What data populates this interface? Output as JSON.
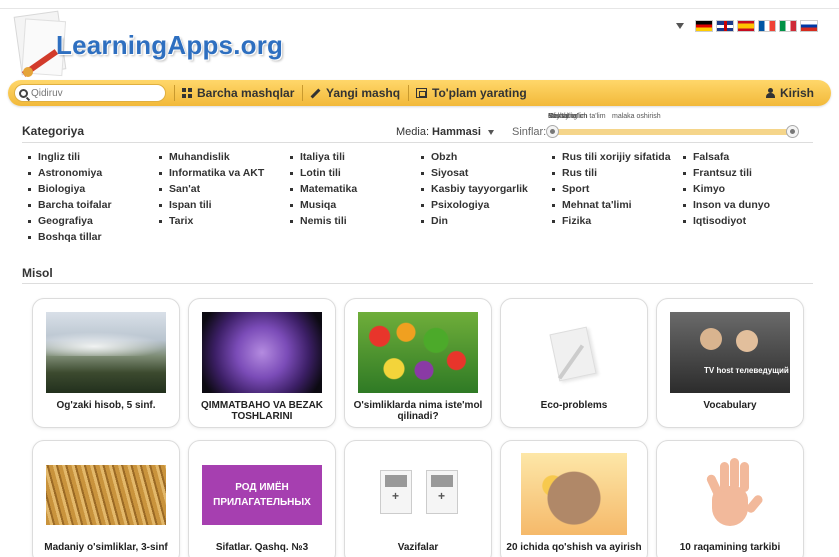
{
  "header": {
    "logo_text": "LearningApps.org",
    "languages": [
      "de",
      "gb",
      "es",
      "fr",
      "it",
      "ru"
    ]
  },
  "navbar": {
    "search_placeholder": "Qidiruv",
    "all_exercises": "Barcha mashqlar",
    "new_exercise": "Yangi mashq",
    "create_collection": "To'plam yarating",
    "login": "Kirish",
    "icons": [
      "search-icon",
      "grid-icon",
      "pencil-icon",
      "collection-icon",
      "user-icon"
    ]
  },
  "filters": {
    "category_label": "Kategoriya",
    "media_label": "Media:",
    "media_value": "Hammasi",
    "grades_label": "Sinflar:",
    "slider_overlap_texts": [
      "Boshlang'ich ta'lim",
      "Maktab",
      "Oliy ta'lim",
      "Kasbiy ta'lim",
      "malaka oshirish"
    ]
  },
  "categories": [
    [
      "Ingliz tili",
      "Astronomiya",
      "Biologiya",
      "Barcha toifalar",
      "Geografiya",
      "Boshqa tillar"
    ],
    [
      "Muhandislik",
      "Informatika va AKT",
      "San'at",
      "Ispan tili",
      "Tarix"
    ],
    [
      "Italiya tili",
      "Lotin tili",
      "Matematika",
      "Musiqa",
      "Nemis tili"
    ],
    [
      "Obzh",
      "Siyosat",
      "Kasbiy tayyorgarlik",
      "Psixologiya",
      "Din"
    ],
    [
      "Rus tili xorijiy sifatida",
      "Rus tili",
      "Sport",
      "Mehnat ta'limi",
      "Fizika"
    ],
    [
      "Falsafa",
      "Frantsuz tili",
      "Kimyo",
      "Inson va dunyo",
      "Iqtisodiyot"
    ]
  ],
  "section_title": "Misol",
  "cards": [
    {
      "title": "Og'zaki hisob, 5 sinf."
    },
    {
      "title": "QIMMATBAHO VA BEZAK TOSHLARINI"
    },
    {
      "title": "O'simliklarda nima iste'mol qilinadi?"
    },
    {
      "title": "Eco-problems"
    },
    {
      "title": "Vocabulary",
      "thumb_text": "TV host телеведущий"
    },
    {
      "title": "Madaniy o'simliklar, 3-sinf"
    },
    {
      "title": "Sifatlar. Qashq. №3",
      "thumb_text": "РОД ИМЁН ПРИЛАГАТЕЛЬНЫХ"
    },
    {
      "title": "Vazifalar"
    },
    {
      "title": "20 ichida qo'shish va ayirish"
    },
    {
      "title": "10 raqamining tarkibi"
    }
  ],
  "colors": {
    "navbar": "#f2b93a",
    "logo": "#2e6fc0",
    "slider_track": "#f5d58a"
  }
}
